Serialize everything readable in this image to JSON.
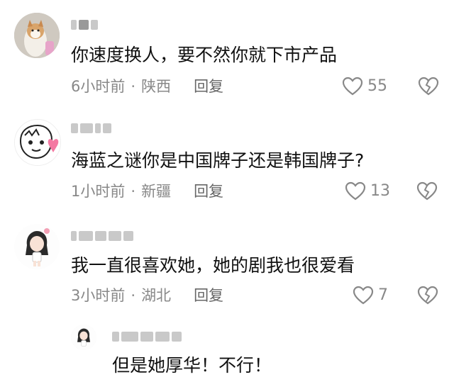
{
  "comments": [
    {
      "text": "你速度换人，要不然你就下市产品",
      "time": "6小时前",
      "location": "陕西",
      "reply_label": "回复",
      "likes": "55",
      "avatar_icon": "dog-avatar-icon"
    },
    {
      "text": "海蓝之谜你是中国牌子还是韩国牌子?",
      "time": "1小时前",
      "location": "新疆",
      "reply_label": "回复",
      "likes": "13",
      "avatar_icon": "cartoon-face-avatar-icon"
    },
    {
      "text": "我一直很喜欢她，她的剧我也很爱看",
      "time": "3小时前",
      "location": "湖北",
      "reply_label": "回复",
      "likes": "7",
      "avatar_icon": "cartoon-girl-avatar-icon"
    }
  ],
  "reply": {
    "text": "但是她厚华！不行！",
    "avatar_icon": "cartoon-girl-avatar-icon"
  },
  "dot": "·",
  "colors": {
    "text": "#111111",
    "meta": "#888888",
    "icon": "#888888",
    "blur": "#c9c9c9"
  }
}
